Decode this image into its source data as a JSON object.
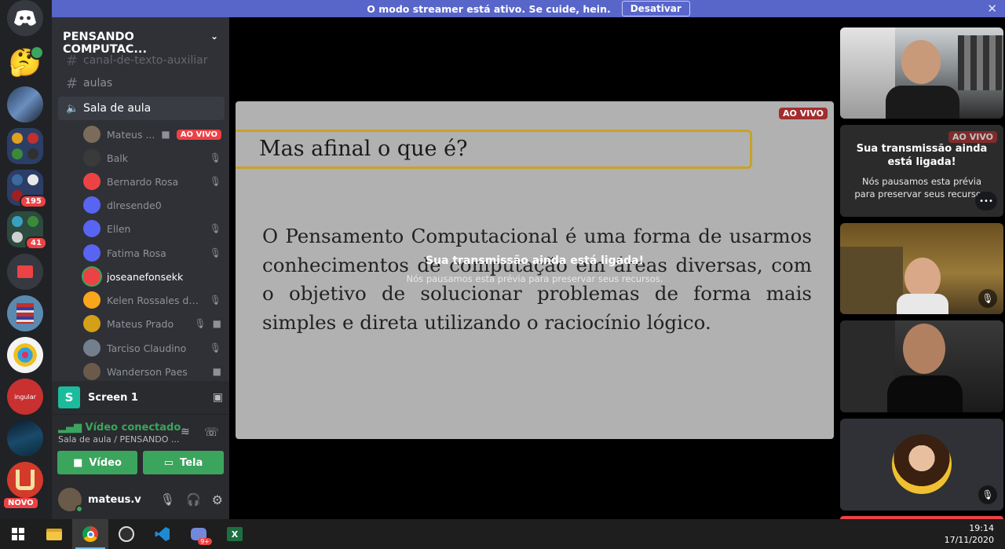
{
  "banner": {
    "message": "O modo streamer está ativo. Se cuide, hein.",
    "deactivate_label": "Desativar",
    "close_icon": "close-icon"
  },
  "rail": {
    "badges": [
      "195",
      "41"
    ],
    "new_label": "NOVO"
  },
  "server": {
    "name": "PENSANDO COMPUTAC...",
    "channels": [
      {
        "label": "canal-de-texto-auxiliar",
        "type": "text"
      },
      {
        "label": "aulas",
        "type": "text"
      },
      {
        "label": "Sala de aula",
        "type": "voice"
      }
    ],
    "voice_users": [
      {
        "name": "Mateus ...",
        "live": "AO VIVO",
        "avatar_color": "#7a6b5a"
      },
      {
        "name": "Balk",
        "avatar_color": "#3a3a3a"
      },
      {
        "name": "Bernardo Rosa",
        "avatar_color": "#ed4245"
      },
      {
        "name": "dlresende0",
        "avatar_color": "#5865f2"
      },
      {
        "name": "Ellen",
        "avatar_color": "#5865f2"
      },
      {
        "name": "Fatima Rosa",
        "avatar_color": "#5865f2"
      },
      {
        "name": "joseanefonsekk",
        "avatar_color": "#ed4245"
      },
      {
        "name": "Kelen Rossales da S...",
        "avatar_color": "#faa61a"
      },
      {
        "name": "Mateus Prado",
        "avatar_color": "#d4a017"
      },
      {
        "name": "Tarciso Claudino",
        "avatar_color": "#747f8d"
      },
      {
        "name": "Wanderson Paes",
        "avatar_color": "#6b5a4a"
      }
    ]
  },
  "screen_panel": {
    "label": "Screen 1",
    "letter": "S"
  },
  "voice_panel": {
    "status": "Vídeo conectado",
    "location": "Sala de aula / PENSANDO ...",
    "video_label": "Vídeo",
    "screen_label": "Tela"
  },
  "user_panel": {
    "username": "mateus.v"
  },
  "slide": {
    "title": "Mas afinal o que é?",
    "body": "O Pensamento Computacional é uma forma de usarmos conhecimentos de computação em áreas diversas, com o objetivo de solucionar problemas de forma mais simples e direta utilizando o raciocínio lógico.",
    "live": "AO VIVO",
    "overlay_title": "Sua transmissão ainda está ligada!",
    "overlay_sub": "Nós pausamos esta prévia para preservar seus recursos."
  },
  "preview_tile": {
    "live": "AO VIVO",
    "title": "Sua transmissão ainda está ligada!",
    "sub": "Nós pausamos esta prévia para preservar seus recursos.",
    "more": "•••"
  },
  "clock": {
    "time": "19:14",
    "date": "17/11/2020"
  },
  "taskbar": {
    "discord_badge": "9+",
    "excel_letter": "X"
  },
  "colors": {
    "accent": "#5865f2",
    "green": "#3ba55d",
    "red": "#ed4245"
  }
}
